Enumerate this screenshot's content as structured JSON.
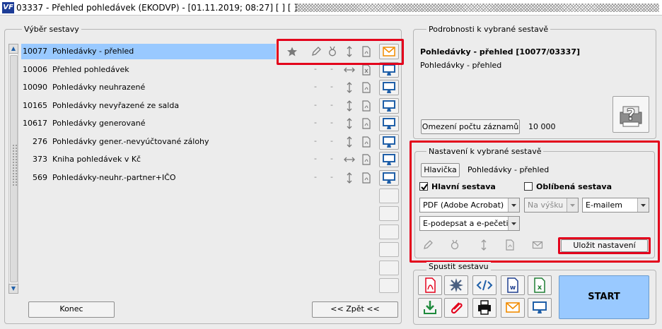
{
  "window": {
    "logo_text": "VF",
    "title": "03337 - Přehled pohledávek (EKODVP) - [01.11.2019; 08:27]  [ ]  [ ]"
  },
  "left_group": {
    "title": "Výběr sestavy",
    "rows": [
      {
        "code": "10077",
        "name": "Pohledávky - přehled",
        "selected": true,
        "output_icon": "envelope-icon"
      },
      {
        "code": "10006",
        "name": "Přehled pohledávek",
        "selected": false,
        "output_icon": "monitor-icon"
      },
      {
        "code": "10090",
        "name": "Pohledávky neuhrazené",
        "selected": false,
        "output_icon": "monitor-icon"
      },
      {
        "code": "10165",
        "name": "Pohledávky nevyřazené ze salda",
        "selected": false,
        "output_icon": "monitor-icon"
      },
      {
        "code": "10617",
        "name": "Pohledávky generované",
        "selected": false,
        "output_icon": "monitor-icon"
      },
      {
        "code": "276",
        "name": "Pohledávky gener.-nevyúčtované zálohy",
        "selected": false,
        "output_icon": "monitor-icon"
      },
      {
        "code": "373",
        "name": "Kniha pohledávek v Kč",
        "selected": false,
        "output_icon": "monitor-icon"
      },
      {
        "code": "569",
        "name": "Pohledávky-neuhr.-partner+IČO",
        "selected": false,
        "output_icon": "monitor-icon"
      }
    ],
    "dash": "-",
    "close_label": "Konec",
    "back_label": "<< Zpět <<"
  },
  "details": {
    "title": "Podrobnosti k vybrané sestavě",
    "report_title": "Pohledávky - přehled [10077/03337]",
    "report_subtitle": "Pohledávky - přehled",
    "limit_label": "Omezení počtu záznamů",
    "limit_value": "10 000"
  },
  "settings": {
    "title": "Nastavení k vybrané sestavě",
    "header_btn": "Hlavička",
    "header_text": "Pohledávky - přehled",
    "main_report_label": "Hlavní sestava",
    "main_report_checked": true,
    "favorite_label": "Oblíbená sestava",
    "favorite_checked": false,
    "format_value": "PDF (Adobe Acrobat)",
    "orientation_value": "Na výšku",
    "delivery_value": "E-mailem",
    "sign_value": "E-podepsat a e-pečetit",
    "save_label": "Uložit nastavení"
  },
  "run": {
    "title": "Spustit sestavu",
    "start_label": "START"
  },
  "colors": {
    "accent_blue": "#1f5fa8",
    "selection": "#99c9ff",
    "highlight_red": "#e3001b",
    "envelope_orange": "#f28c00"
  }
}
